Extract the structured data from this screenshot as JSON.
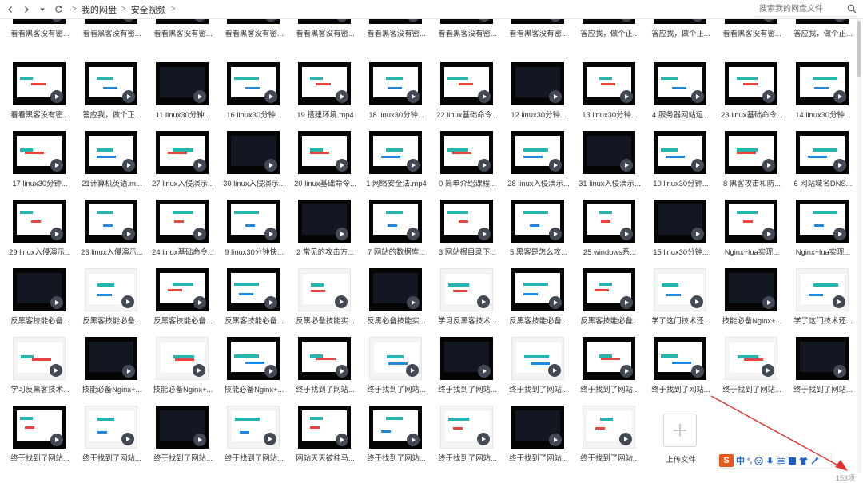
{
  "nav": {
    "back_icon": "chevron-left-icon",
    "forward_icon": "chevron-right-icon",
    "history_icon": "dropdown-caret-icon",
    "refresh_icon": "refresh-icon"
  },
  "breadcrumbs": [
    "我的网盘",
    "安全视频"
  ],
  "search": {
    "placeholder": "搜索我的网盘文件",
    "icon": "search-icon"
  },
  "rows": [
    [
      "看看黑客没有密...",
      "看看黑客没有密...",
      "看看黑客没有密...",
      "看看黑客没有密...",
      "看看黑客没有密...",
      "看看黑客没有密...",
      "看看黑客没有密...",
      "看看黑客没有密...",
      "答应我，做个正...",
      "答应我，做个正...",
      "看看黑客没有密...",
      "答应我，做个正..."
    ],
    [
      "看看黑客没有密...",
      "答应我，做个正...",
      "11 linux30分钟...",
      "16 linux30分钟...",
      "19 搭建环境.mp4",
      "18 linux30分钟...",
      "22 linux基础命令...",
      "12 linux30分钟...",
      "13 linux30分钟...",
      "4 服务器网站运...",
      "23 linux基础命令...",
      "14 linux30分钟..."
    ],
    [
      "17 linux30分钟...",
      "21计算机英语.m...",
      "27 linux入侵演示...",
      "30 linux入侵演示...",
      "20 linux基础命令...",
      "1 网络安全法.mp4",
      "0 简单介绍课程...",
      "28 linux入侵演示...",
      "31 linux入侵演示...",
      "10 linux30分钟...",
      "8 黑客攻击和防...",
      "6 网站域名DNS..."
    ],
    [
      "29 linux入侵演示...",
      "26 linux入侵演示...",
      "24 linux基础命令...",
      "9 linux30分钟快...",
      "2 常见的攻击方...",
      "7 网站的数据库...",
      "3 网站根目录下...",
      "5 黑客是怎么攻...",
      "25 windows系...",
      "15 linux30分钟...",
      "Nginx+lua实现...",
      "Nginx+lua实现..."
    ],
    [
      "反黑客技能必备...",
      "反黑客技能必备...",
      "反黑客技能必备...",
      "反黑客技能必备...",
      "反黑必备技能实...",
      "反黑必备技能实...",
      "学习反黑客技术...",
      "反黑客技能必备...",
      "反黑客技能必备...",
      "学了这门技术还...",
      "技能必备Nginx+...",
      "学了这门技术还..."
    ],
    [
      "学习反黑客技术...",
      "技能必备Nginx+...",
      "技能必备Nginx+...",
      "技能必备Nginx+...",
      "终于找到了网站...",
      "终于找到了网站...",
      "终于找到了网站...",
      "终于找到了网站...",
      "终于找到了网站...",
      "终于找到了网站...",
      "终于找到了网站...",
      "终于找到了网站..."
    ],
    [
      "终于找到了网站...",
      "终于找到了网站...",
      "终于找到了网站...",
      "终于找到了网站...",
      "网站天天被挂马...",
      "终于找到了网站...",
      "终于找到了网站...",
      "终于找到了网站...",
      "终于找到了网站..."
    ]
  ],
  "upload": {
    "label": "上传文件",
    "icon": "plus-icon"
  },
  "status": {
    "count": "153项"
  },
  "ime": {
    "brand": "S",
    "mode": "中",
    "punct": "°,"
  }
}
